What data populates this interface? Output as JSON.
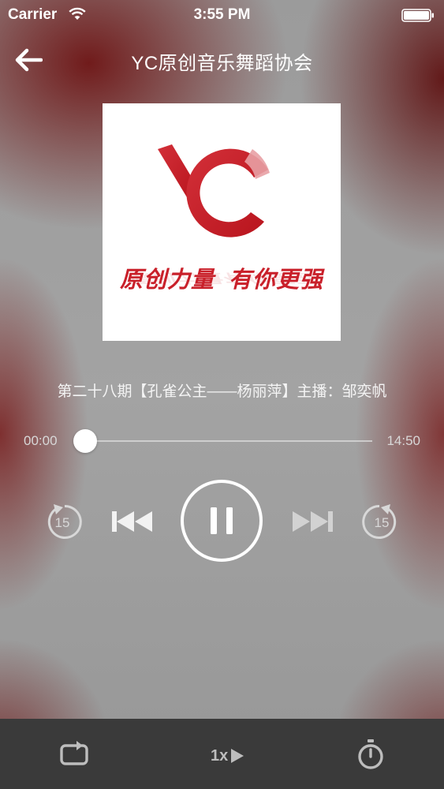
{
  "status_bar": {
    "carrier": "Carrier",
    "time": "3:55 PM",
    "icons": [
      "wifi-icon",
      "battery-icon"
    ]
  },
  "nav": {
    "title": "YC原创音乐舞蹈协会",
    "back_icon": "arrow-left-icon"
  },
  "cover": {
    "logo_letters": "YC",
    "slogan_left": "原创力量",
    "slogan_right": "有你更强"
  },
  "track": {
    "title": "第二十八期【孔雀公主——杨丽萍】主播：邹奕帆"
  },
  "progress": {
    "elapsed": "00:00",
    "total": "14:50",
    "fraction": 0.03
  },
  "controls": {
    "rewind_seconds": "15",
    "forward_seconds": "15",
    "state": "playing"
  },
  "bottom_bar": {
    "speed_label": "1x",
    "icons": [
      "repeat-icon",
      "play-triangle-icon",
      "timer-icon"
    ]
  },
  "colors": {
    "brand_red": "#c9202a",
    "bottom_bar": "#3a3a3a"
  }
}
